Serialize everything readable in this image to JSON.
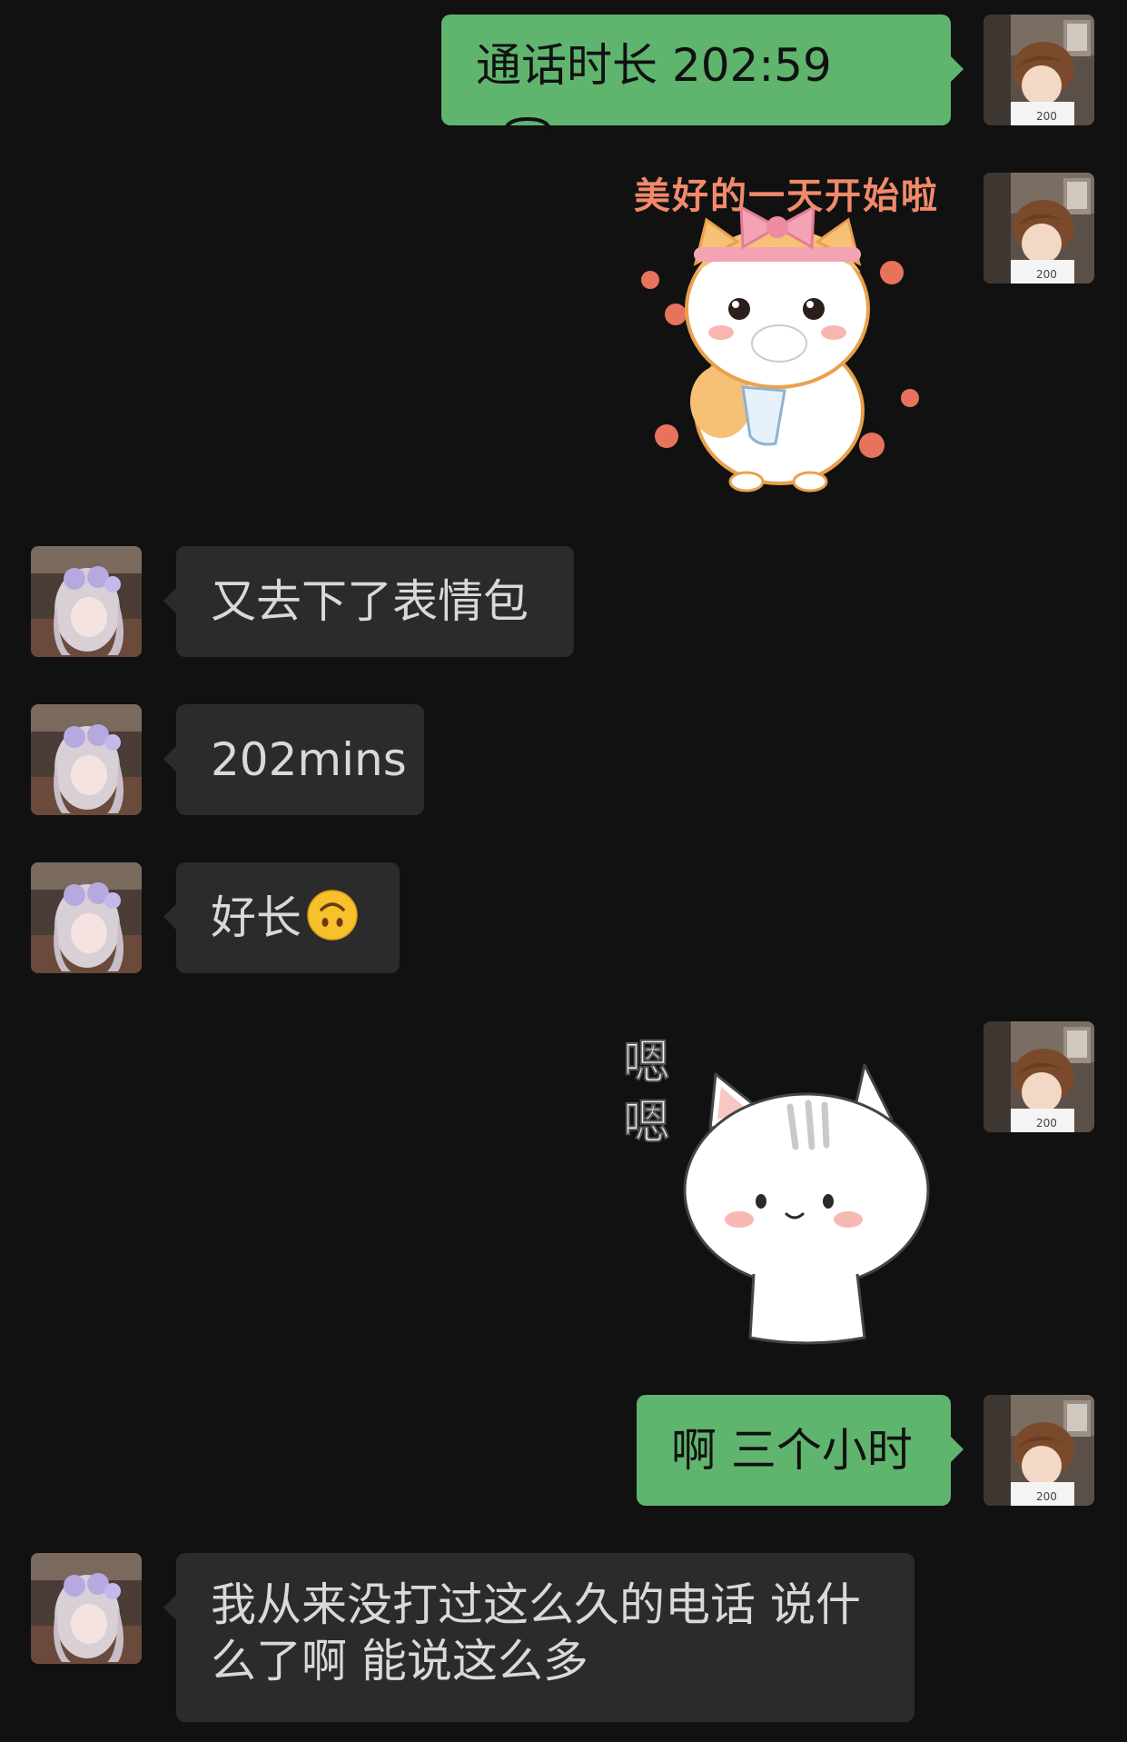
{
  "chat": {
    "messages": [
      {
        "id": "m1",
        "side": "out",
        "type": "call",
        "label": "通话时长 202:59",
        "icon": "phone-hangup-icon"
      },
      {
        "id": "m2",
        "side": "out",
        "type": "sticker",
        "sticker_text": "美好的一天开始啦",
        "sticker": "cat-eating-sticker"
      },
      {
        "id": "m3",
        "side": "in",
        "type": "text",
        "text": "又去下了表情包"
      },
      {
        "id": "m4",
        "side": "in",
        "type": "text",
        "text": "202mins"
      },
      {
        "id": "m5",
        "side": "in",
        "type": "text",
        "text": "好长",
        "emoji": "upside-down-face-icon"
      },
      {
        "id": "m6",
        "side": "out",
        "type": "sticker",
        "sticker_text": "嗯嗯",
        "sticker": "white-cat-sticker"
      },
      {
        "id": "m7",
        "side": "out",
        "type": "text",
        "text": "啊 三个小时"
      },
      {
        "id": "m8",
        "side": "in",
        "type": "text",
        "line1": "我从来没打过这么久的电话 说什",
        "line2": "么了啊 能说这么多"
      }
    ],
    "sticker1_text": "美好的一天开始啦",
    "sticker2_text_top": "嗯",
    "sticker2_text_bottom": "嗯"
  },
  "colors": {
    "background": "#111111",
    "outgoing_bubble": "#5FB56E",
    "incoming_bubble": "#2B2B2B",
    "incoming_text": "#D9D9D9"
  }
}
